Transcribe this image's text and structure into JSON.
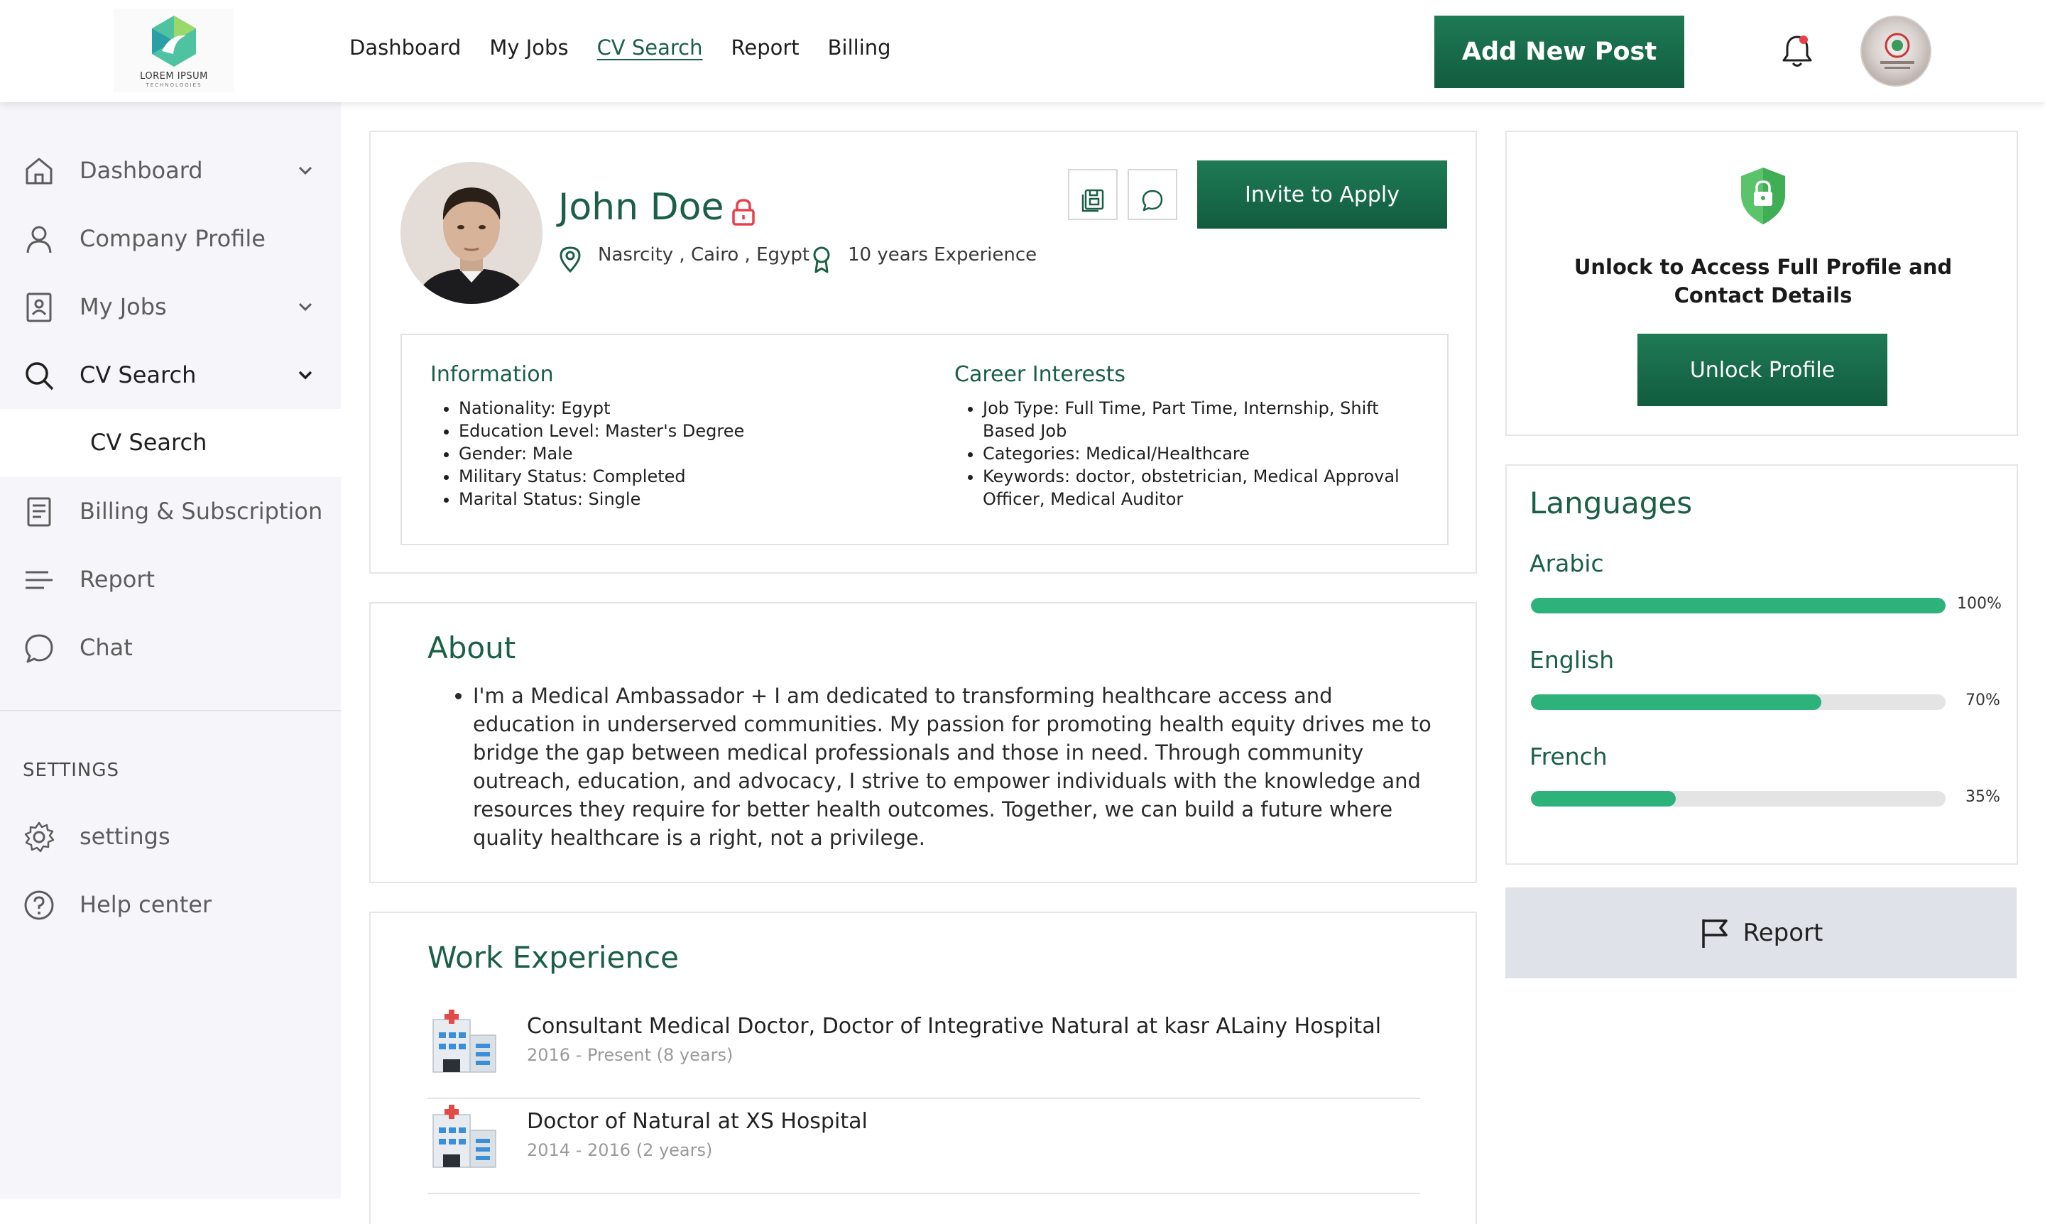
{
  "brand": {
    "logo_text": "LOREM IPSUM",
    "logo_sub": "TECHNOLOGIES"
  },
  "topnav": {
    "items": [
      "Dashboard",
      "My Jobs",
      "CV Search",
      "Report",
      "Billing"
    ],
    "active": "CV Search",
    "add_post_label": "Add New Post"
  },
  "sidebar": {
    "items": [
      {
        "label": "Dashboard",
        "icon": "home-icon",
        "has_chevron": true
      },
      {
        "label": "Company Profile",
        "icon": "user-icon",
        "has_chevron": false
      },
      {
        "label": "My Jobs",
        "icon": "id-card-icon",
        "has_chevron": true
      },
      {
        "label": "CV Search",
        "icon": "search-icon",
        "has_chevron": true,
        "active": true
      },
      {
        "label": "Billing & Subscription",
        "icon": "document-icon",
        "has_chevron": false
      },
      {
        "label": "Report",
        "icon": "menu-lines-icon",
        "has_chevron": false
      },
      {
        "label": "Chat",
        "icon": "chat-icon",
        "has_chevron": false
      }
    ],
    "sub_item": "CV Search",
    "settings_heading": "SETTINGS",
    "settings_items": [
      {
        "label": "settings",
        "icon": "gear-icon"
      },
      {
        "label": "Help center",
        "icon": "help-icon"
      }
    ]
  },
  "profile": {
    "name": "John Doe",
    "location": "Nasrcity , Cairo , Egypt",
    "experience": "10 years Experience",
    "invite_label": "Invite to Apply",
    "information": {
      "title": "Information",
      "items": [
        "Nationality: Egypt",
        "Education Level: Master's Degree",
        "Gender: Male",
        "Military Status: Completed",
        "Marital Status: Single"
      ]
    },
    "career": {
      "title": "Career Interests",
      "items": [
        "Job Type: Full Time, Part Time, Internship, Shift Based Job",
        "Categories: Medical/Healthcare",
        "Keywords: doctor, obstetrician, Medical Approval Officer, Medical Auditor"
      ]
    }
  },
  "about": {
    "title": "About",
    "text": "I'm a Medical Ambassador + I am dedicated to transforming healthcare access and education in underserved communities. My passion for promoting health equity drives me to bridge the gap between medical professionals and those in need. Through community outreach, education, and advocacy, I strive to empower individuals with the knowledge and resources they require for better health outcomes. Together, we can build a future where quality healthcare is a right, not a privilege."
  },
  "work": {
    "title": "Work Experience",
    "jobs": [
      {
        "title": "Consultant Medical Doctor, Doctor of Integrative Natural at kasr ALainy Hospital",
        "dates": "2016 - Present (8 years)"
      },
      {
        "title": "Doctor of Natural at XS Hospital",
        "dates": "2014 - 2016 (2 years)"
      }
    ]
  },
  "unlock": {
    "text_line1": "Unlock to Access Full Profile and",
    "text_line2": "Contact Details",
    "button_label": "Unlock Profile"
  },
  "languages": {
    "title": "Languages",
    "items": [
      {
        "name": "Arabic",
        "percent": 100,
        "label": "100%"
      },
      {
        "name": "English",
        "percent": 70,
        "label": "70%"
      },
      {
        "name": "French",
        "percent": 35,
        "label": "35%"
      }
    ]
  },
  "report_label": "Report",
  "colors": {
    "brand_green": "#1a5f46",
    "button_green": "#1e7a55",
    "progress_green": "#2db27c",
    "lock_red": "#e8404a",
    "report_bg": "#dfe2e8"
  }
}
